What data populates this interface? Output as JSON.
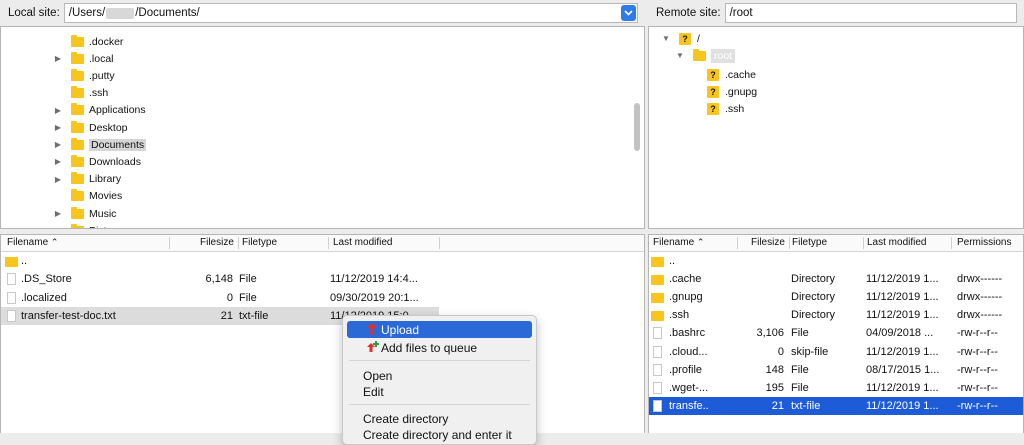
{
  "local_site": {
    "label": "Local site:",
    "path_prefix": "/Users/",
    "path_suffix": "/Documents/"
  },
  "remote_site": {
    "label": "Remote site:",
    "path": "/root"
  },
  "local_tree": [
    {
      "name": ".docker",
      "arrow": false
    },
    {
      "name": ".local",
      "arrow": true
    },
    {
      "name": ".putty",
      "arrow": false
    },
    {
      "name": ".ssh",
      "arrow": false
    },
    {
      "name": "Applications",
      "arrow": true
    },
    {
      "name": "Desktop",
      "arrow": true
    },
    {
      "name": "Documents",
      "arrow": true,
      "selected": true
    },
    {
      "name": "Downloads",
      "arrow": true
    },
    {
      "name": "Library",
      "arrow": true
    },
    {
      "name": "Movies",
      "arrow": false
    },
    {
      "name": "Music",
      "arrow": true
    },
    {
      "name": "Pict",
      "arrow": true
    }
  ],
  "remote_tree": {
    "root_slash": "/",
    "root_dir": "root",
    "children": [
      ".cache",
      ".gnupg",
      ".ssh"
    ]
  },
  "local_columns": {
    "filename": "Filename",
    "filesize": "Filesize",
    "filetype": "Filetype",
    "modified": "Last modified"
  },
  "local_files": [
    {
      "name": "..",
      "size": "",
      "type": "",
      "modified": "",
      "icon": "folder"
    },
    {
      "name": ".DS_Store",
      "size": "6,148",
      "type": "File",
      "modified": "11/12/2019 14:4...",
      "icon": "doc"
    },
    {
      "name": ".localized",
      "size": "0",
      "type": "File",
      "modified": "09/30/2019 20:1...",
      "icon": "doc"
    },
    {
      "name": "transfer-test-doc.txt",
      "size": "21",
      "type": "txt-file",
      "modified": "11/12/2019 15:0...",
      "icon": "doc",
      "selected": true
    }
  ],
  "remote_columns": {
    "filename": "Filename",
    "filesize": "Filesize",
    "filetype": "Filetype",
    "modified": "Last modified",
    "permissions": "Permissions"
  },
  "remote_files": [
    {
      "name": "..",
      "size": "",
      "type": "",
      "modified": "",
      "perms": "",
      "icon": "folder"
    },
    {
      "name": ".cache",
      "size": "",
      "type": "Directory",
      "modified": "11/12/2019 1...",
      "perms": "drwx------",
      "icon": "folder"
    },
    {
      "name": ".gnupg",
      "size": "",
      "type": "Directory",
      "modified": "11/12/2019 1...",
      "perms": "drwx------",
      "icon": "folder"
    },
    {
      "name": ".ssh",
      "size": "",
      "type": "Directory",
      "modified": "11/12/2019 1...",
      "perms": "drwx------",
      "icon": "folder"
    },
    {
      "name": ".bashrc",
      "size": "3,106",
      "type": "File",
      "modified": "04/09/2018 ...",
      "perms": "-rw-r--r--",
      "icon": "doc"
    },
    {
      "name": ".cloud...",
      "size": "0",
      "type": "skip-file",
      "modified": "11/12/2019 1...",
      "perms": "-rw-r--r--",
      "icon": "doc"
    },
    {
      "name": ".profile",
      "size": "148",
      "type": "File",
      "modified": "08/17/2015 1...",
      "perms": "-rw-r--r--",
      "icon": "doc"
    },
    {
      "name": ".wget-...",
      "size": "195",
      "type": "File",
      "modified": "11/12/2019 1...",
      "perms": "-rw-r--r--",
      "icon": "doc"
    },
    {
      "name": "transfe..",
      "size": "21",
      "type": "txt-file",
      "modified": "11/12/2019 1...",
      "perms": "-rw-r--r--",
      "icon": "doc",
      "selected": true
    }
  ],
  "context_menu": {
    "upload": "Upload",
    "add_queue": "Add files to queue",
    "open": "Open",
    "edit": "Edit",
    "create_dir": "Create directory",
    "create_dir_enter": "Create directory and enter it"
  },
  "colors": {
    "accent": "#2a69d6",
    "selection": "#1e5bd6",
    "folder": "#f7c51b"
  }
}
